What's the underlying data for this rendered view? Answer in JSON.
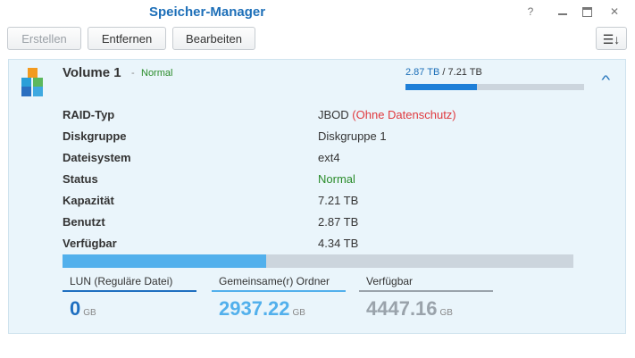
{
  "window": {
    "title": "Speicher-Manager",
    "controls": {
      "help": "?",
      "close": "✕"
    }
  },
  "toolbar": {
    "create_label": "Erstellen",
    "remove_label": "Entfernen",
    "edit_label": "Bearbeiten",
    "sort_icon": "sort-icon",
    "sort_glyph": "☰↓"
  },
  "volume": {
    "name": "Volume 1",
    "separator": "-",
    "status_short": "Normal",
    "used": "2.87 TB",
    "slash": "/",
    "total": "7.21 TB",
    "usage_fraction": 0.398,
    "collapse_glyph": "^"
  },
  "details": [
    {
      "label": "RAID-Typ",
      "value": "JBOD",
      "note": "(Ohne Datenschutz)"
    },
    {
      "label": "Diskgruppe",
      "value": "Diskgruppe 1"
    },
    {
      "label": "Dateisystem",
      "value": "ext4"
    },
    {
      "label": "Status",
      "value": "Normal"
    },
    {
      "label": "Kapazität",
      "value": "7.21 TB"
    },
    {
      "label": "Benutzt",
      "value": "2.87 TB"
    },
    {
      "label": "Verfügbar",
      "value": "4.34 TB"
    }
  ],
  "breakdown": {
    "fill_fraction": 0.398,
    "items": [
      {
        "label": "LUN (Reguläre Datei)",
        "value": "0",
        "unit": "GB",
        "color": "#1e6fc0"
      },
      {
        "label": "Gemeinsame(r) Ordner",
        "value": "2937.22",
        "unit": "GB",
        "color": "#52b0ec"
      },
      {
        "label": "Verfügbar",
        "value": "4447.16",
        "unit": "GB",
        "color": "#9aa3ab"
      }
    ]
  },
  "colors": {
    "accent": "#1d6fb8",
    "normal": "#2a8c2a",
    "warning": "#e0393e"
  }
}
